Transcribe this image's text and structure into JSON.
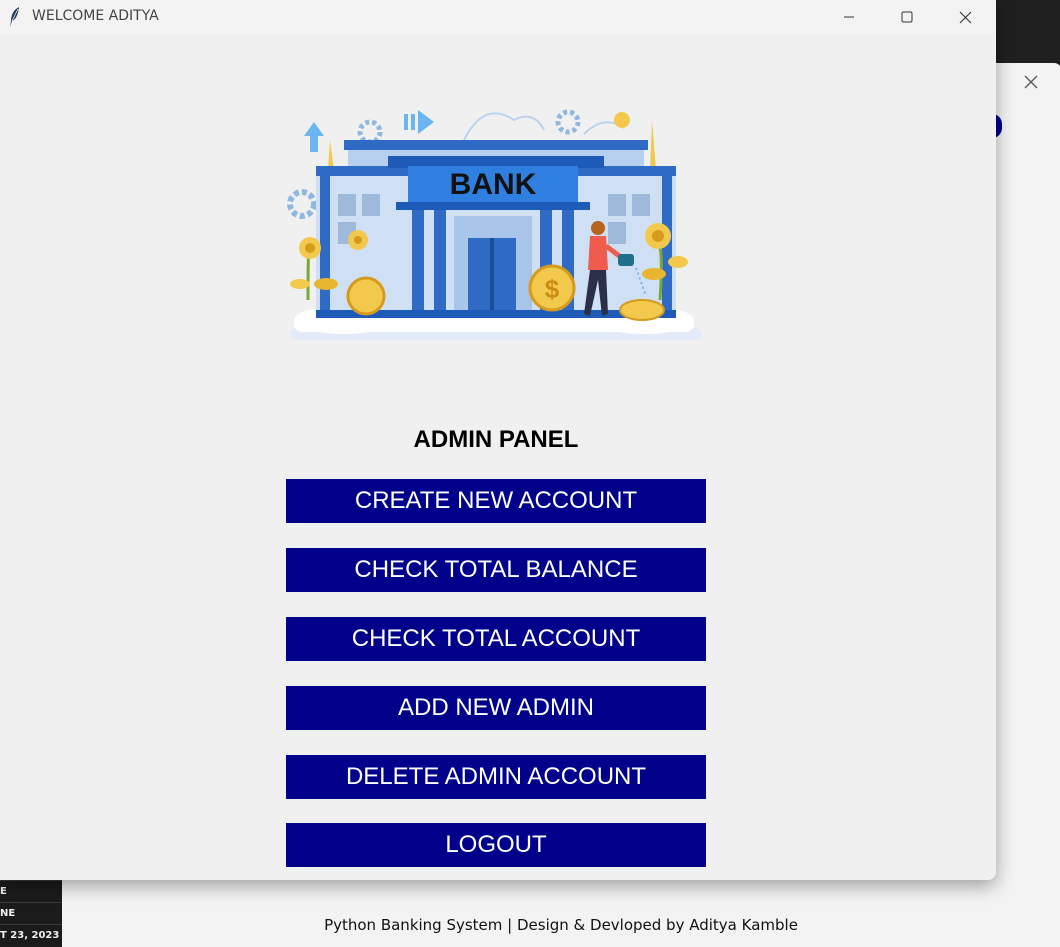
{
  "window": {
    "title": "WELCOME ADITYA"
  },
  "admin_panel": {
    "title": "ADMIN PANEL",
    "buttons": {
      "create_account": "CREATE NEW ACCOUNT",
      "check_balance": "CHECK TOTAL BALANCE",
      "check_accounts": "CHECK TOTAL ACCOUNT",
      "add_admin": "ADD NEW ADMIN",
      "delete_admin": "DELETE ADMIN ACCOUNT",
      "logout": "LOGOUT"
    }
  },
  "illustration": {
    "sign_text": "BANK",
    "coin_symbol": "$"
  },
  "background_window": {
    "footer": "Python Banking System | Design & Devloped by Aditya Kamble"
  },
  "left_strip": {
    "rows": [
      "E",
      "NE",
      "T 23, 2023"
    ]
  },
  "colors": {
    "button_bg": "#00008b",
    "button_text": "#ffffff",
    "window_bg": "#f0f0f0"
  },
  "icons": {
    "app": "feather-icon",
    "minimize": "minimize-icon",
    "maximize": "maximize-icon",
    "close": "close-icon"
  }
}
